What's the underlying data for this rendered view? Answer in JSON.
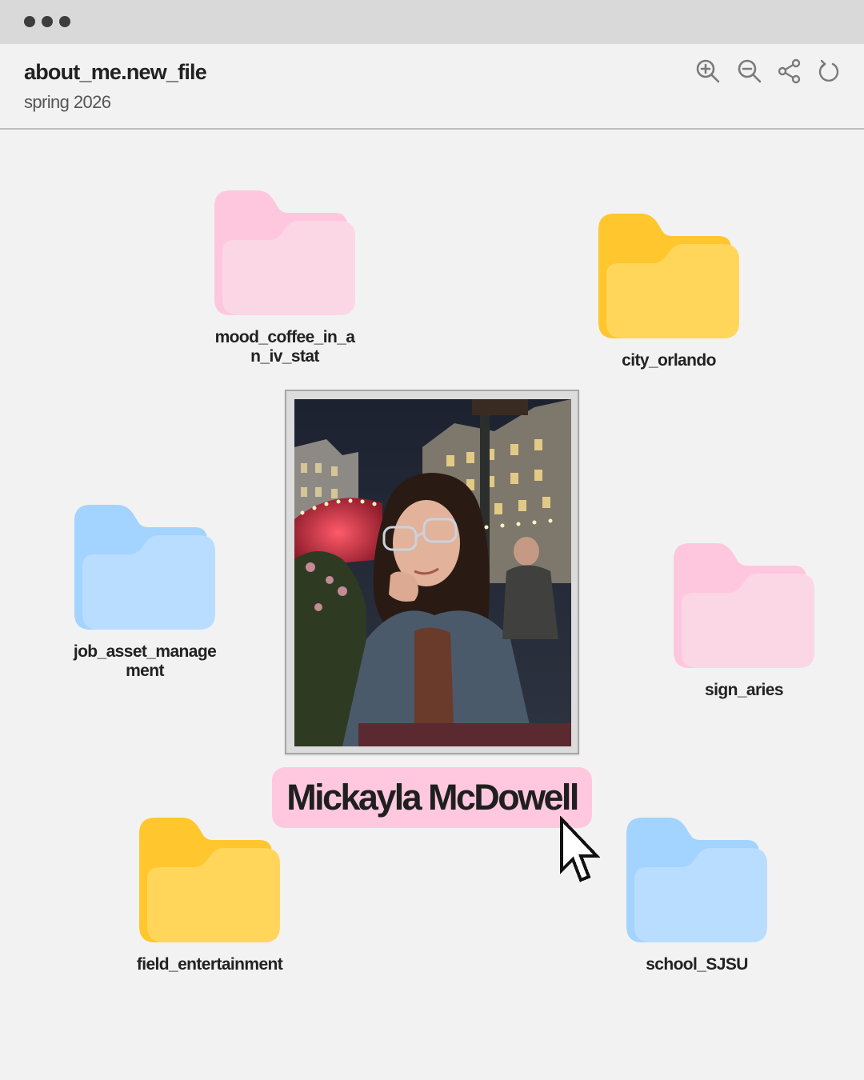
{
  "window": {
    "title": "about_me.new_file",
    "subtitle": "spring 2026",
    "toolbar": {
      "zoom_in_icon": "zoom-in-icon",
      "zoom_out_icon": "zoom-out-icon",
      "share_icon": "share-icon",
      "refresh_icon": "refresh-icon"
    }
  },
  "folders": [
    {
      "label": "mood_coffee_in_an_iv_stat",
      "color": "pink"
    },
    {
      "label": "city_orlando",
      "color": "yellow"
    },
    {
      "label": "job_asset_management",
      "color": "blue"
    },
    {
      "label": "sign_aries",
      "color": "pink"
    },
    {
      "label": "field_entertainment",
      "color": "yellow"
    },
    {
      "label": "school_SJSU",
      "color": "blue"
    }
  ],
  "profile": {
    "name": "Mickayla McDowell"
  },
  "colors": {
    "background": "#f2f2f2",
    "titlebar": "#d9d9d9",
    "folder_pink_back": "#ffc7de",
    "folder_pink_front": "#fbd6e5",
    "folder_yellow_back": "#ffc62e",
    "folder_yellow_front": "#ffd659",
    "folder_blue_back": "#a3d3ff",
    "folder_blue_front": "#b9ddff",
    "name_badge": "#ffc8de"
  }
}
